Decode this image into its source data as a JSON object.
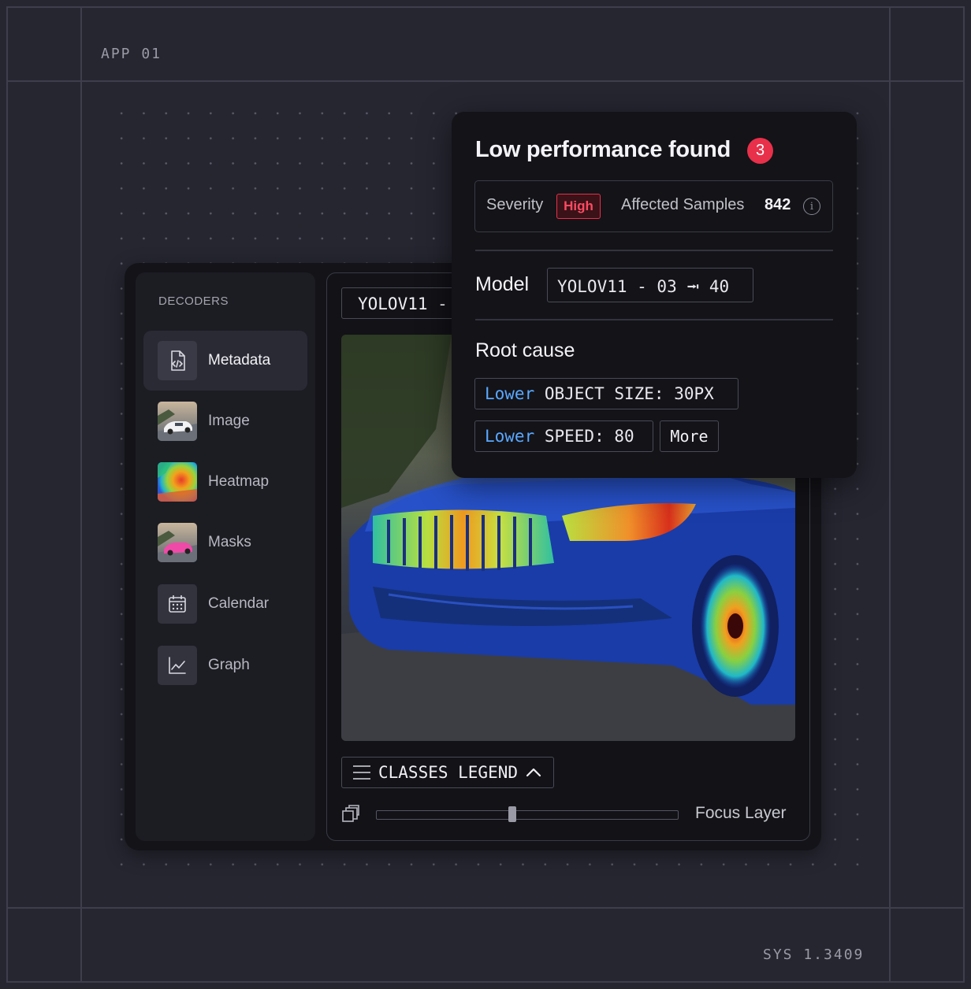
{
  "frame": {
    "top_label": "APP 01",
    "bottom_label": "SYS 1.3409"
  },
  "sidebar": {
    "title": "DECODERS",
    "items": [
      {
        "label": "Metadata",
        "icon": "code-file-icon",
        "active": true
      },
      {
        "label": "Image",
        "icon": "car-thumbnail",
        "active": false
      },
      {
        "label": "Heatmap",
        "icon": "heatmap-thumbnail",
        "active": false
      },
      {
        "label": "Masks",
        "icon": "mask-thumbnail",
        "active": false
      },
      {
        "label": "Calendar",
        "icon": "calendar-icon",
        "active": false
      },
      {
        "label": "Graph",
        "icon": "line-graph-icon",
        "active": false
      }
    ]
  },
  "viewer": {
    "model_chip": "YOLOV11 - 03",
    "legend_button": "CLASSES LEGEND",
    "focus_label": "Focus Layer",
    "focus_level": 0.45
  },
  "popup": {
    "title": "Low performance found",
    "count": "3",
    "severity_label": "Severity",
    "severity_value": "High",
    "affected_label": "Affected Samples",
    "affected_value": "842",
    "model_label": "Model",
    "model_value": "YOLOV11 - 03 ⭲ 40",
    "root_cause_label": "Root cause",
    "causes": [
      {
        "keyword": "Lower",
        "text": " OBJECT SIZE: 30PX"
      },
      {
        "keyword": "Lower",
        "text": " SPEED: 80"
      }
    ],
    "more_label": "More"
  },
  "colors": {
    "background": "#262631",
    "panel": "#131318",
    "accent_red": "#e8304a",
    "keyword_blue": "#5aa8ff"
  }
}
